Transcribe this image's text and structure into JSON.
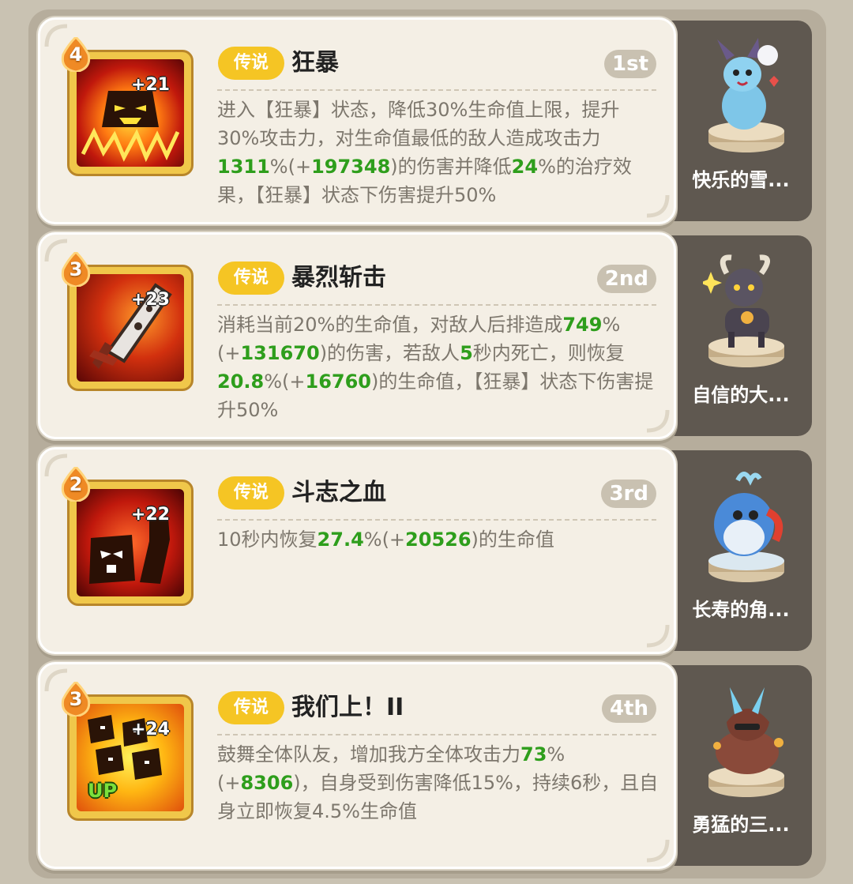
{
  "skills": [
    {
      "level": "4",
      "plus": "+21",
      "rarity": "传说",
      "name": "狂暴",
      "rank": "1st",
      "pet_name": "快乐的雪...",
      "up": "",
      "icon": "berserk-icon",
      "desc": [
        {
          "t": "进入【狂暴】状态，降低30%生命值上限，提升30%攻击力，对生命值最低的敌人造成攻击力"
        },
        {
          "t": "1311",
          "g": true
        },
        {
          "t": "%(+"
        },
        {
          "t": "197348",
          "g": true
        },
        {
          "t": ")的伤害并降低"
        },
        {
          "t": "24",
          "g": true
        },
        {
          "t": "%的治疗效果，【狂暴】状态下伤害提升50%"
        }
      ]
    },
    {
      "level": "3",
      "plus": "+23",
      "rarity": "传说",
      "name": "暴烈斩击",
      "rank": "2nd",
      "pet_name": "自信的大...",
      "up": "",
      "icon": "sword-slash-icon",
      "desc": [
        {
          "t": "消耗当前20%的生命值，对敌人后排造成"
        },
        {
          "t": "749",
          "g": true
        },
        {
          "t": "%(+"
        },
        {
          "t": "131670",
          "g": true
        },
        {
          "t": ")的伤害，若敌人"
        },
        {
          "t": "5",
          "g": true
        },
        {
          "t": "秒内死亡，则恢复"
        },
        {
          "t": "20.8",
          "g": true
        },
        {
          "t": "%(+"
        },
        {
          "t": "16760",
          "g": true
        },
        {
          "t": ")的生命值，【狂暴】状态下伤害提升50%"
        }
      ]
    },
    {
      "level": "2",
      "plus": "+22",
      "rarity": "传说",
      "name": "斗志之血",
      "rank": "3rd",
      "pet_name": "长寿的角...",
      "up": "",
      "icon": "fighting-blood-icon",
      "desc": [
        {
          "t": "10秒内恢复"
        },
        {
          "t": "27.4",
          "g": true
        },
        {
          "t": "%(+"
        },
        {
          "t": "20526",
          "g": true
        },
        {
          "t": ")的生命值"
        }
      ]
    },
    {
      "level": "3",
      "plus": "+24",
      "rarity": "传说",
      "name": "我们上！II",
      "rank": "4th",
      "pet_name": "勇猛的三...",
      "up": "UP",
      "icon": "rally-charge-icon",
      "desc": [
        {
          "t": "鼓舞全体队友，增加我方全体攻击力"
        },
        {
          "t": "73",
          "g": true
        },
        {
          "t": "%(+"
        },
        {
          "t": "8306",
          "g": true
        },
        {
          "t": ")，自身受到伤害降低15%，持续6秒，且自身立即恢复4.5%生命值"
        }
      ]
    }
  ]
}
